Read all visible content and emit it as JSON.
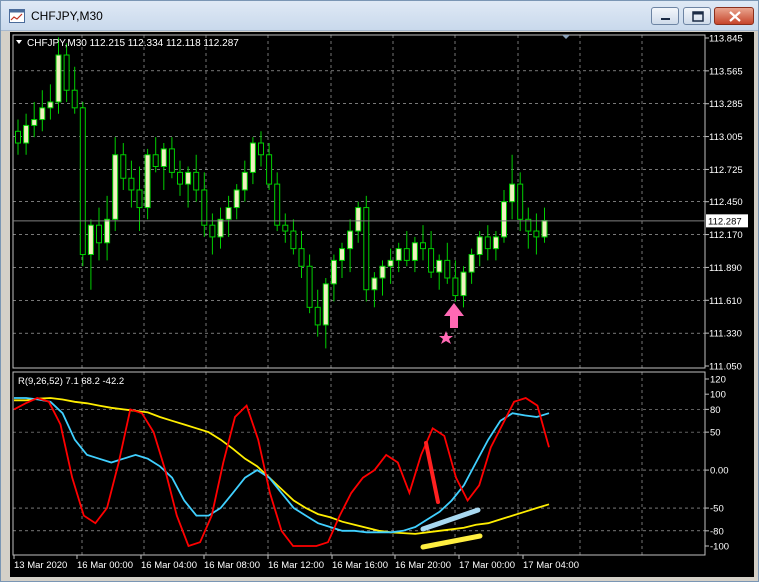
{
  "window": {
    "title": "CHFJPY,M30"
  },
  "main_chart": {
    "info": "CHFJPY,M30  112.215 112.334 112.118 112.287",
    "price_ticks": [
      "113.845",
      "113.565",
      "113.285",
      "113.005",
      "112.725",
      "112.450",
      "112.170",
      "111.890",
      "111.610",
      "111.330",
      "111.050"
    ],
    "price_min": 111.05,
    "price_max": 113.845,
    "current_price": "112.287",
    "current_price_value": 112.287
  },
  "indicator": {
    "label": "R(9,26,52) 7.1 68.2 -42.2",
    "ticks": [
      "120",
      "100",
      "80",
      "50",
      "0.00",
      "-50",
      "-80",
      "-100"
    ],
    "tick_values": [
      120,
      100,
      80,
      50,
      0,
      -50,
      -80,
      -100
    ]
  },
  "time_axis": {
    "labels": [
      "13 Mar 2020",
      "16 Mar 00:00",
      "16 Mar 04:00",
      "16 Mar 08:00",
      "16 Mar 12:00",
      "16 Mar 16:00",
      "16 Mar 20:00",
      "17 Mar 00:00",
      "17 Mar 04:00"
    ]
  },
  "colors": {
    "bull_candle": "#000000",
    "candle_stroke": "#00d000",
    "bull_body_fill": "#f0f0c0",
    "grid": "#c0c0c0",
    "fast_line": "#ff0000",
    "mid_line": "#40d0ff",
    "slow_line": "#ffee00",
    "arrow": "#ff69b4"
  },
  "icons": {
    "app": "chart-window-icon",
    "minimize": "minimize-icon",
    "maximize": "maximize-icon",
    "close": "close-icon",
    "marker": "star-icon",
    "signal": "up-arrow-icon"
  }
}
